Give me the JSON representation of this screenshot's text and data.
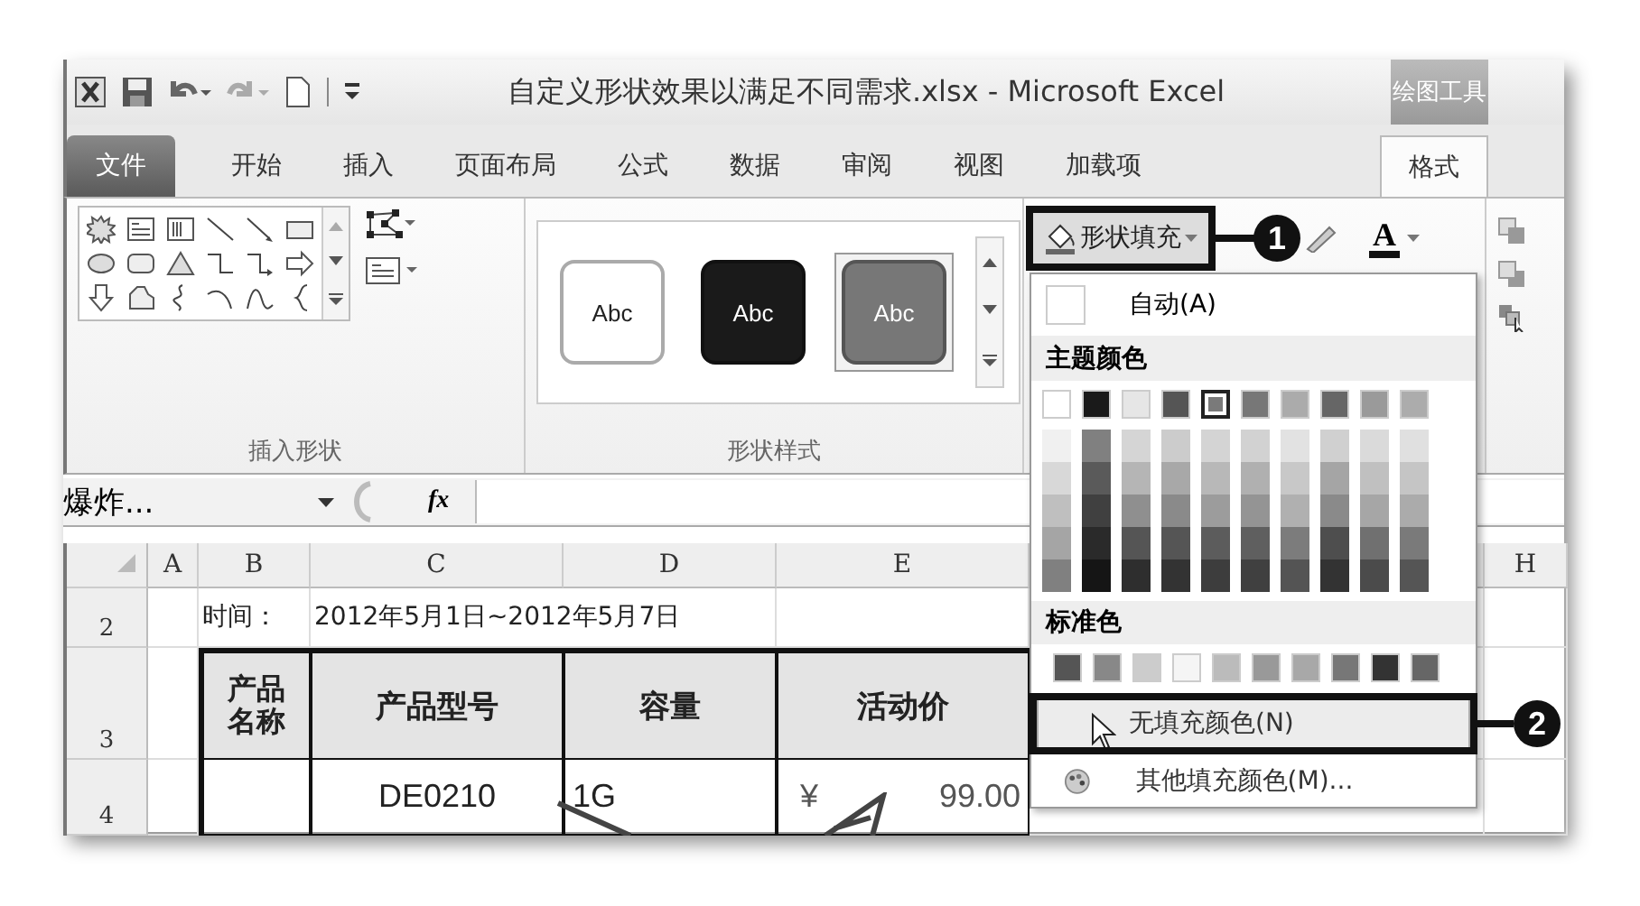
{
  "title_bar": {
    "title": "自定义形状效果以满足不同需求.xlsx - Microsoft Excel",
    "context_tab": "绘图工具"
  },
  "tabs": [
    {
      "label": "文件",
      "kind": "file",
      "selected": false
    },
    {
      "label": "开始",
      "kind": "tab",
      "selected": false
    },
    {
      "label": "插入",
      "kind": "tab",
      "selected": false
    },
    {
      "label": "页面布局",
      "kind": "tab",
      "selected": false
    },
    {
      "label": "公式",
      "kind": "tab",
      "selected": false
    },
    {
      "label": "数据",
      "kind": "tab",
      "selected": false
    },
    {
      "label": "审阅",
      "kind": "tab",
      "selected": false
    },
    {
      "label": "视图",
      "kind": "tab",
      "selected": false
    },
    {
      "label": "加载项",
      "kind": "tab",
      "selected": false
    },
    {
      "label": "格式",
      "kind": "context",
      "selected": true
    }
  ],
  "ribbon": {
    "groups": [
      {
        "label": "插入形状"
      },
      {
        "label": "形状样式"
      }
    ],
    "shape_styles": [
      {
        "label": "Abc",
        "kind": "light",
        "selected": false
      },
      {
        "label": "Abc",
        "kind": "dark",
        "selected": false
      },
      {
        "label": "Abc",
        "kind": "medium",
        "selected": true
      }
    ],
    "fill_button": {
      "label": "形状填充",
      "expanded": true,
      "callout": "1"
    },
    "font_color_button": {
      "label": "A"
    }
  },
  "formula_bar": {
    "name_box": "爆炸...",
    "function_label": "fx"
  },
  "sheet": {
    "columns": [
      "A",
      "B",
      "C",
      "D",
      "E",
      "H"
    ],
    "rows": [
      {
        "header": "2",
        "kind": "plain",
        "cells": [
          {
            "text": ""
          },
          {
            "text": "时间："
          },
          {
            "text": "2012年5月1日~2012年5月7日",
            "colspan": 2
          },
          {
            "text": ""
          },
          {
            "text": ""
          }
        ]
      },
      {
        "header": "3",
        "kind": "table_header",
        "cells": [
          {
            "text": ""
          },
          {
            "text": "产品名称"
          },
          {
            "text": "产品型号"
          },
          {
            "text": "容量"
          },
          {
            "text": "活动价"
          },
          {
            "text": ""
          }
        ]
      },
      {
        "header": "4",
        "kind": "table_body",
        "cells": [
          {
            "text": ""
          },
          {
            "text": ""
          },
          {
            "text": "DE0210"
          },
          {
            "text": "1G"
          },
          {
            "currency": "¥",
            "text": "99.00"
          },
          {
            "text": ""
          }
        ]
      }
    ]
  },
  "fill_menu": {
    "items": [
      {
        "kind": "auto",
        "label": "自动(A)"
      },
      {
        "kind": "heading",
        "label": "主题颜色"
      },
      {
        "kind": "theme",
        "colors": [
          {
            "color": "#ffffff",
            "selected": false
          },
          {
            "color": "#1a1a1a",
            "selected": false
          },
          {
            "color": "#e6e6e6",
            "selected": false
          },
          {
            "color": "#555555",
            "selected": false
          },
          {
            "color": "#7a7a7a",
            "selected": true
          },
          {
            "color": "#777777",
            "selected": false
          },
          {
            "color": "#ababab",
            "selected": false
          },
          {
            "color": "#666666",
            "selected": false
          },
          {
            "color": "#9a9a9a",
            "selected": false
          },
          {
            "color": "#acacac",
            "selected": false
          }
        ],
        "shades": [
          [
            {
              "color": "#f0f0f0"
            },
            {
              "color": "#d8d8d8"
            },
            {
              "color": "#bfbfbf"
            },
            {
              "color": "#a5a5a5"
            },
            {
              "color": "#808080"
            }
          ],
          [
            {
              "color": "#808080"
            },
            {
              "color": "#5a5a5a"
            },
            {
              "color": "#404040"
            },
            {
              "color": "#2a2a2a"
            },
            {
              "color": "#151515"
            }
          ],
          [
            {
              "color": "#d5d5d5"
            },
            {
              "color": "#b5b5b5"
            },
            {
              "color": "#8f8f8f"
            },
            {
              "color": "#555555"
            },
            {
              "color": "#2e2e2e"
            }
          ],
          [
            {
              "color": "#cccccc"
            },
            {
              "color": "#a8a8a8"
            },
            {
              "color": "#8a8a8a"
            },
            {
              "color": "#555555"
            },
            {
              "color": "#333333"
            }
          ],
          [
            {
              "color": "#d4d4d4"
            },
            {
              "color": "#b8b8b8"
            },
            {
              "color": "#9c9c9c"
            },
            {
              "color": "#5c5c5c"
            },
            {
              "color": "#3d3d3d"
            }
          ],
          [
            {
              "color": "#d2d2d2"
            },
            {
              "color": "#b0b0b0"
            },
            {
              "color": "#949494"
            },
            {
              "color": "#5f5f5f"
            },
            {
              "color": "#404040"
            }
          ],
          [
            {
              "color": "#e2e2e2"
            },
            {
              "color": "#c8c8c8"
            },
            {
              "color": "#b0b0b0"
            },
            {
              "color": "#7c7c7c"
            },
            {
              "color": "#545454"
            }
          ],
          [
            {
              "color": "#d0d0d0"
            },
            {
              "color": "#a5a5a5"
            },
            {
              "color": "#8a8a8a"
            },
            {
              "color": "#4e4e4e"
            },
            {
              "color": "#333333"
            }
          ],
          [
            {
              "color": "#dadada"
            },
            {
              "color": "#c0c0c0"
            },
            {
              "color": "#a6a6a6"
            },
            {
              "color": "#707070"
            },
            {
              "color": "#4b4b4b"
            }
          ],
          [
            {
              "color": "#e0e0e0"
            },
            {
              "color": "#c5c5c5"
            },
            {
              "color": "#ababab"
            },
            {
              "color": "#7a7a7a"
            },
            {
              "color": "#555555"
            }
          ]
        ]
      },
      {
        "kind": "heading",
        "label": "标准色"
      },
      {
        "kind": "standard",
        "colors": [
          {
            "color": "#555555"
          },
          {
            "color": "#888888"
          },
          {
            "color": "#cccccc"
          },
          {
            "color": "#f5f5f5"
          },
          {
            "color": "#bbbbbb"
          },
          {
            "color": "#999999"
          },
          {
            "color": "#a8a8a8"
          },
          {
            "color": "#777777"
          },
          {
            "color": "#333333"
          },
          {
            "color": "#666666"
          }
        ]
      },
      {
        "kind": "no_fill",
        "label": "无填充颜色(N)",
        "selected": true,
        "callout": "2"
      },
      {
        "kind": "more_colors",
        "label": "其他填充颜色(M)...",
        "selected": false
      }
    ]
  }
}
